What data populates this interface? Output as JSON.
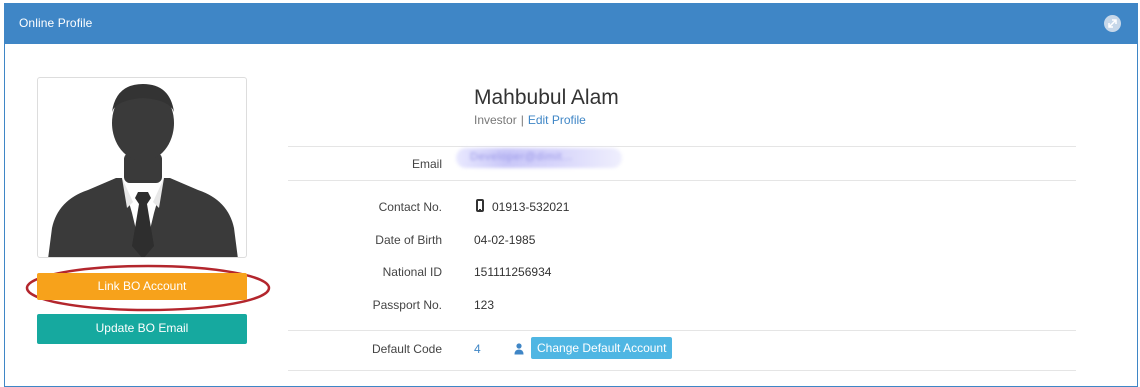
{
  "panel": {
    "title": "Online Profile",
    "collapse_icon": "collapse-icon"
  },
  "profile": {
    "name": "Mahbubul Alam",
    "role": "Investor",
    "separator": "|",
    "edit_link": "Edit Profile",
    "avatar_icon": "person-silhouette"
  },
  "actions": {
    "link_bo": "Link BO Account",
    "update_bo_email": "Update BO Email"
  },
  "fields": {
    "email_label": "Email",
    "email_value": "Developer@dimit...",
    "contact_label": "Contact No.",
    "contact_value": "01913-532021",
    "dob_label": "Date of Birth",
    "dob_value": "04-02-1985",
    "nid_label": "National ID",
    "nid_value": "151111256934",
    "passport_label": "Passport No.",
    "passport_value": "123",
    "default_code_label": "Default Code",
    "default_code_value": "4",
    "change_default_btn": "Change Default Account"
  },
  "colors": {
    "header": "#3f86c6",
    "link_button": "#f7a21b",
    "update_button": "#16a99f",
    "change_button": "#4fb6e3",
    "highlight_ellipse": "#b3262d"
  }
}
